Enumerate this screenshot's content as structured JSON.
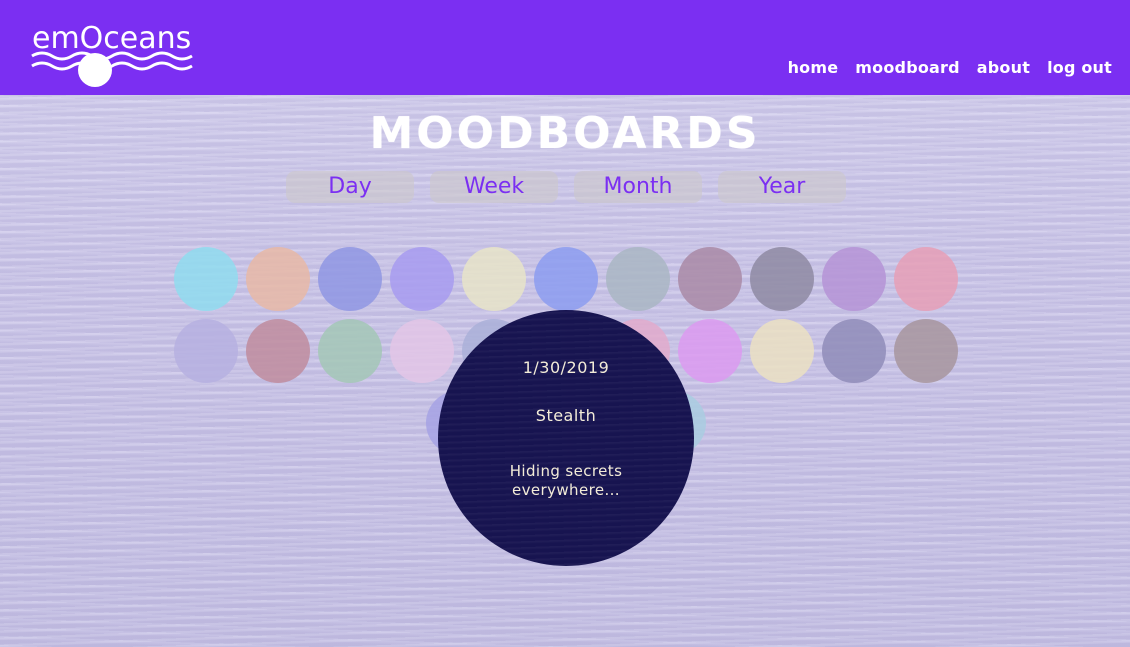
{
  "brand": {
    "name": "emOceans"
  },
  "nav": {
    "items": [
      "home",
      "moodboard",
      "about",
      "log out"
    ]
  },
  "page": {
    "title": "MOODBOARDS"
  },
  "tabs": [
    "Day",
    "Week",
    "Month",
    "Year"
  ],
  "mood_circles": {
    "row1": [
      "#8fdcef",
      "#e7b8a6",
      "#8f97e3",
      "#a79bf0",
      "#e8e4c8",
      "#8c9cf0",
      "#a9b6c3",
      "#a98aa6",
      "#8e8aa2",
      "#b593d6",
      "#e69fb6"
    ],
    "row2": [
      "#b6b0e0",
      "#bf8c9e",
      "#a3c7b6",
      "#e3c6e6",
      "#aab0d8",
      "#c8ccd8",
      "#e2aacb",
      "#dc9af0",
      "#ebe0c2",
      "#8f8cb8",
      "#a7959e"
    ],
    "row3": [
      "#a6a2e4",
      "#a9cde0"
    ]
  },
  "popup": {
    "date": "1/30/2019",
    "mood": "Stealth",
    "note": "Hiding secrets everywhere...",
    "color": "#171450"
  },
  "colors": {
    "header": "#7b2ff2",
    "tab_text": "#7b2ff2"
  }
}
